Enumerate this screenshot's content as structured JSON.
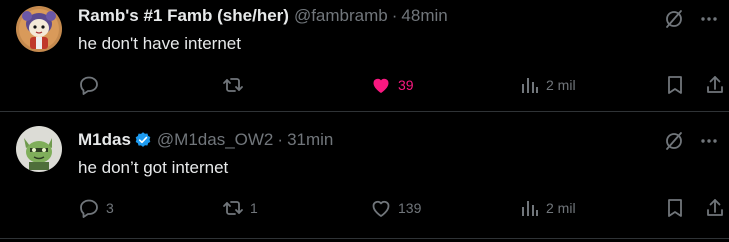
{
  "colors": {
    "background": "#000000",
    "text_primary": "#e7e9ea",
    "text_secondary": "#71767b",
    "like_active": "#f91880",
    "verified_blue": "#1d9bf0",
    "divider": "#2f3336"
  },
  "tweets": [
    {
      "display_name": "Ramb's #1 Famb (she/her)",
      "handle": "@fambramb",
      "separator": "·",
      "time": "48min",
      "verified": false,
      "text": "he don't have internet",
      "avatar_icon": "cartoon-girl-avatar",
      "actions": {
        "reply": {
          "icon": "reply-icon",
          "count": ""
        },
        "retweet": {
          "icon": "retweet-icon",
          "count": ""
        },
        "like": {
          "icon": "heart-filled-icon",
          "count": "39",
          "active": true
        },
        "views": {
          "icon": "views-bar-icon",
          "count": "2 mil"
        },
        "bookmark": {
          "icon": "bookmark-icon"
        },
        "share": {
          "icon": "share-icon"
        }
      }
    },
    {
      "display_name": "M1das",
      "handle": "@M1das_OW2",
      "separator": "·",
      "time": "31min",
      "verified": true,
      "text": "he don’t got internet",
      "avatar_icon": "green-cat-avatar",
      "actions": {
        "reply": {
          "icon": "reply-icon",
          "count": "3"
        },
        "retweet": {
          "icon": "retweet-icon",
          "count": "1"
        },
        "like": {
          "icon": "heart-outline-icon",
          "count": "139",
          "active": false
        },
        "views": {
          "icon": "views-bar-icon",
          "count": "2 mil"
        },
        "bookmark": {
          "icon": "bookmark-icon"
        },
        "share": {
          "icon": "share-icon"
        }
      }
    }
  ],
  "top_right_icons": [
    "grok-slash-icon",
    "more-options-icon"
  ]
}
